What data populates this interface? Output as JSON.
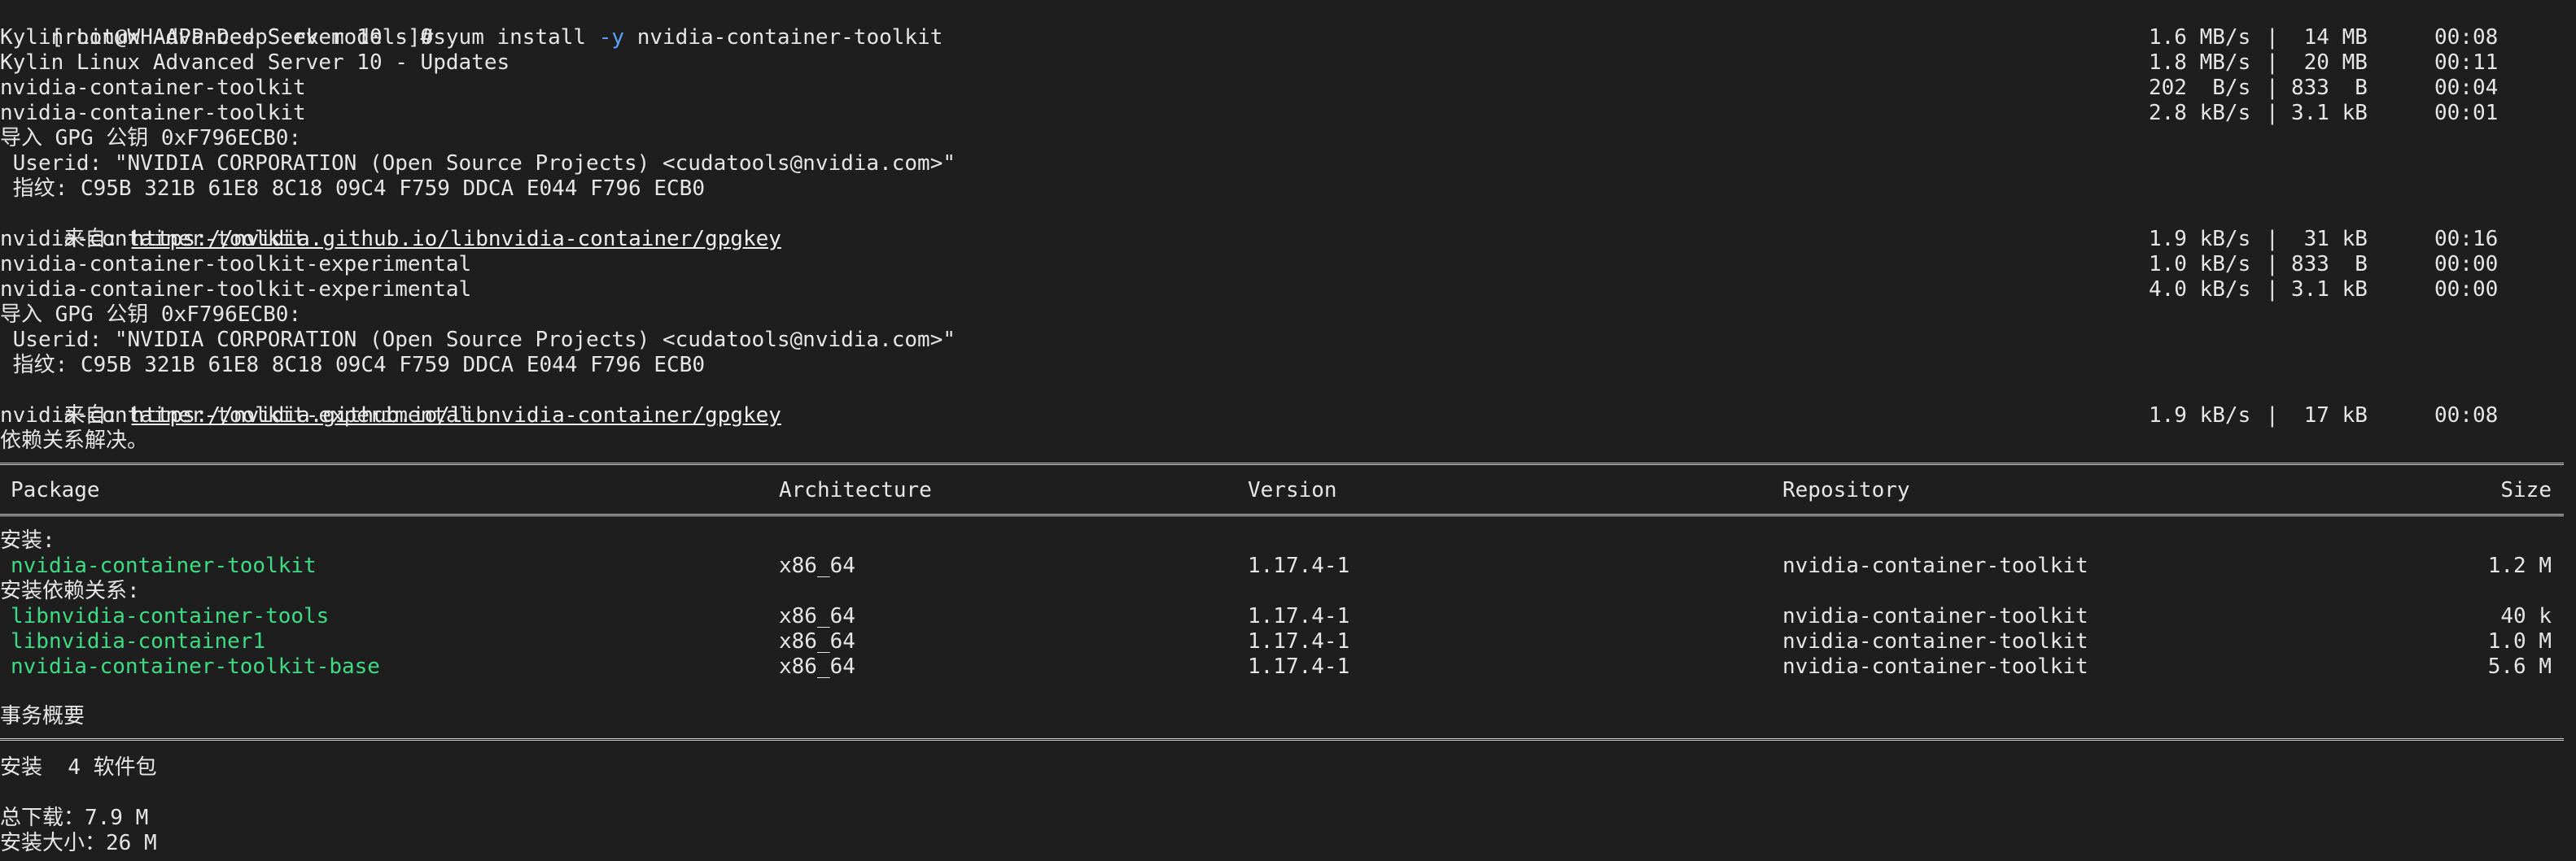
{
  "prompt": {
    "host": "[root@WH-APP-DeepSeek models]# ",
    "cmd_pre": "yum install ",
    "flag": "-y",
    "cmd_post": " nvidia-container-toolkit"
  },
  "repo_lines": [
    {
      "name": "Kylin Linux Advanced Server 10 - Os",
      "rate": "1.6 MB/s",
      "size": " 14 MB",
      "time": "00:08"
    },
    {
      "name": "Kylin Linux Advanced Server 10 - Updates",
      "rate": "1.8 MB/s",
      "size": " 20 MB",
      "time": "00:11"
    },
    {
      "name": "nvidia-container-toolkit",
      "rate": "202  B/s",
      "size": "833  B",
      "time": "00:04"
    },
    {
      "name": "nvidia-container-toolkit",
      "rate": "2.8 kB/s",
      "size": "3.1 kB",
      "time": "00:01"
    }
  ],
  "gpg1": {
    "import": "导入 GPG 公钥 0xF796ECB0:",
    "userid": " Userid: \"NVIDIA CORPORATION (Open Source Projects) <cudatools@nvidia.com>\"",
    "fp": " 指纹: C95B 321B 61E8 8C18 09C4 F759 DDCA E044 F796 ECB0",
    "from_label": " 来自: ",
    "url": "https://nvidia.github.io/libnvidia-container/gpgkey"
  },
  "repo_lines2": [
    {
      "name": "nvidia-container-toolkit",
      "rate": "1.9 kB/s",
      "size": " 31 kB",
      "time": "00:16"
    },
    {
      "name": "nvidia-container-toolkit-experimental",
      "rate": "1.0 kB/s",
      "size": "833  B",
      "time": "00:00"
    },
    {
      "name": "nvidia-container-toolkit-experimental",
      "rate": "4.0 kB/s",
      "size": "3.1 kB",
      "time": "00:00"
    }
  ],
  "gpg2": {
    "import": "导入 GPG 公钥 0xF796ECB0:",
    "userid": " Userid: \"NVIDIA CORPORATION (Open Source Projects) <cudatools@nvidia.com>\"",
    "fp": " 指纹: C95B 321B 61E8 8C18 09C4 F759 DDCA E044 F796 ECB0",
    "from_label": " 来自: ",
    "url": "https://nvidia.github.io/libnvidia-container/gpgkey"
  },
  "repo_line3": {
    "name": "nvidia-container-toolkit-experimental",
    "rate": "1.9 kB/s",
    "size": " 17 kB",
    "time": "00:08"
  },
  "deps_resolved": "依赖关系解决。",
  "table": {
    "headers": {
      "package": "Package",
      "arch": "Architecture",
      "version": "Version",
      "repo": "Repository",
      "size": "Size"
    },
    "install_label": "安装:",
    "deps_label": "安装依赖关系:",
    "install_rows": [
      {
        "package": "nvidia-container-toolkit",
        "arch": "x86_64",
        "version": "1.17.4-1",
        "repo": "nvidia-container-toolkit",
        "size": "1.2 M"
      }
    ],
    "dep_rows": [
      {
        "package": "libnvidia-container-tools",
        "arch": "x86_64",
        "version": "1.17.4-1",
        "repo": "nvidia-container-toolkit",
        "size": "40 k"
      },
      {
        "package": "libnvidia-container1",
        "arch": "x86_64",
        "version": "1.17.4-1",
        "repo": "nvidia-container-toolkit",
        "size": "1.0 M"
      },
      {
        "package": "nvidia-container-toolkit-base",
        "arch": "x86_64",
        "version": "1.17.4-1",
        "repo": "nvidia-container-toolkit",
        "size": "5.6 M"
      }
    ]
  },
  "summary": {
    "title": "事务概要",
    "install_count": "安装  4 软件包",
    "total_download": "总下载：7.9 M",
    "install_size": "安装大小：26 M"
  },
  "colors": {
    "background": "#1e1e1e",
    "text": "#e6e6e6",
    "package_green": "#3ddc84",
    "flag_blue": "#5aa0ff"
  }
}
